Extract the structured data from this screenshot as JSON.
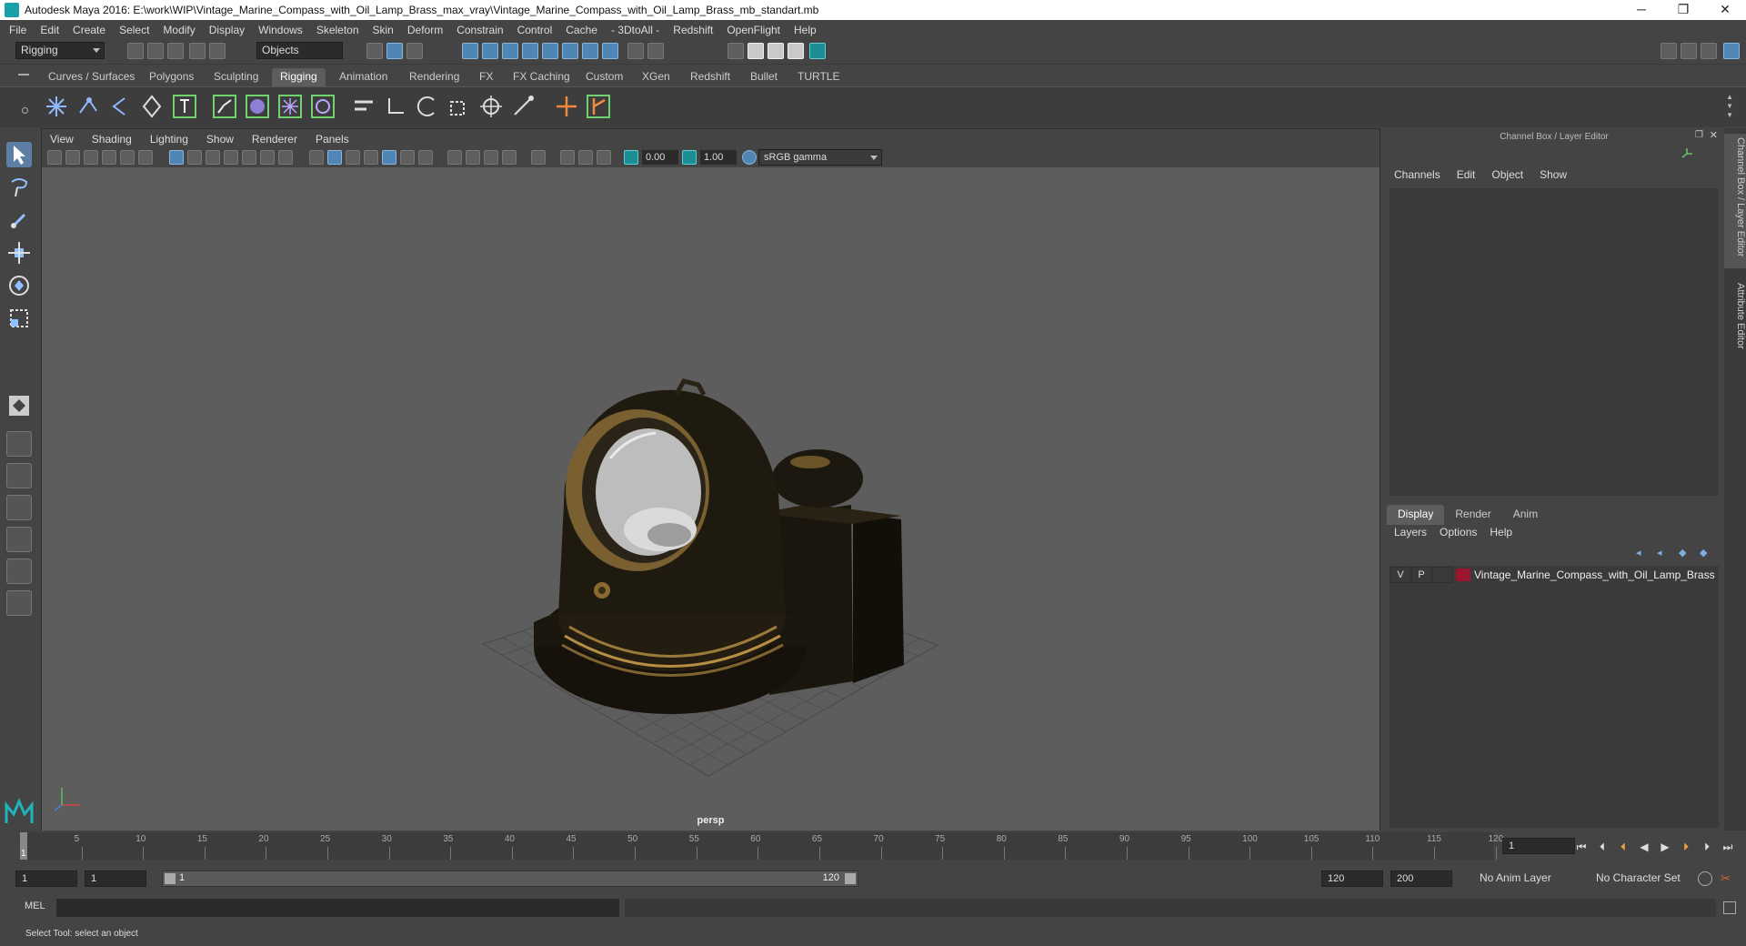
{
  "window": {
    "title": "Autodesk Maya 2016: E:\\work\\WIP\\Vintage_Marine_Compass_with_Oil_Lamp_Brass_max_vray\\Vintage_Marine_Compass_with_Oil_Lamp_Brass_mb_standart.mb",
    "minimize": "─",
    "restore": "❐",
    "close": "✕"
  },
  "menubar": [
    "File",
    "Edit",
    "Create",
    "Select",
    "Modify",
    "Display",
    "Windows",
    "Skeleton",
    "Skin",
    "Deform",
    "Constrain",
    "Control",
    "Cache",
    "- 3DtoAll -",
    "Redshift",
    "OpenFlight",
    "Help"
  ],
  "statusline": {
    "menuset": "Rigging",
    "selection_mode": "Objects"
  },
  "shelf": {
    "tabs": [
      "Curves / Surfaces",
      "Polygons",
      "Sculpting",
      "Rigging",
      "Animation",
      "Rendering",
      "FX",
      "FX Caching",
      "Custom",
      "XGen",
      "Redshift",
      "Bullet",
      "TURTLE"
    ],
    "active_tab": "Rigging"
  },
  "viewport": {
    "menu": [
      "View",
      "Shading",
      "Lighting",
      "Show",
      "Renderer",
      "Panels"
    ],
    "exposure": "0.00",
    "gamma": "1.00",
    "color_space": "sRGB gamma",
    "camera_label": "persp"
  },
  "channel_box": {
    "title": "Channel Box / Layer Editor",
    "menu": [
      "Channels",
      "Edit",
      "Object",
      "Show"
    ]
  },
  "side_tabs": {
    "channel_box": "Channel Box / Layer Editor",
    "attribute_editor": "Attribute Editor"
  },
  "layer_editor": {
    "tabs": [
      "Display",
      "Render",
      "Anim"
    ],
    "active_tab": "Display",
    "menu": [
      "Layers",
      "Options",
      "Help"
    ],
    "layers": [
      {
        "visible": "V",
        "playback": "P",
        "name": "Vintage_Marine_Compass_with_Oil_Lamp_Brass",
        "color": "#9a1530"
      }
    ]
  },
  "timeline": {
    "ticks": [
      "5",
      "10",
      "15",
      "20",
      "25",
      "30",
      "35",
      "40",
      "45",
      "50",
      "55",
      "60",
      "65",
      "70",
      "75",
      "80",
      "85",
      "90",
      "95",
      "100",
      "105",
      "110",
      "115",
      "120"
    ],
    "current_frame_label": "1",
    "current_frame_field": "1"
  },
  "range_slider": {
    "start_frame": "1",
    "playback_start": "1",
    "slider_start": "1",
    "slider_end": "120",
    "playback_end": "120",
    "end_frame": "200",
    "anim_layer": "No Anim Layer",
    "character_set": "No Character Set"
  },
  "command_line": {
    "label": "MEL"
  },
  "help_line": "Select Tool: select an object"
}
